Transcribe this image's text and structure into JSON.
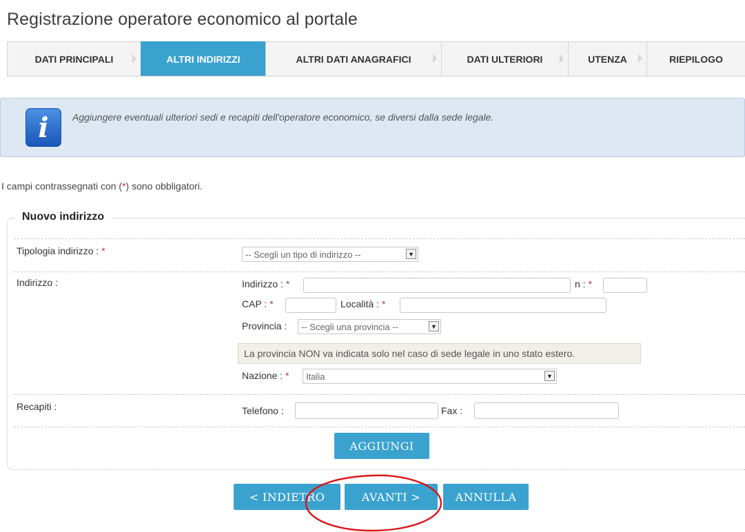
{
  "page": {
    "title": "Registrazione operatore economico al portale"
  },
  "tabs": [
    {
      "label": "DATI PRINCIPALI",
      "active": false
    },
    {
      "label": "ALTRI INDIRIZZI",
      "active": true
    },
    {
      "label": "ALTRI DATI ANAGRAFICI",
      "active": false
    },
    {
      "label": "DATI ULTERIORI",
      "active": false
    },
    {
      "label": "UTENZA",
      "active": false
    },
    {
      "label": "RIEPILOGO",
      "active": false
    }
  ],
  "info": {
    "icon": "info-icon",
    "text": "Aggiungere eventuali ulteriori sedi e recapiti dell'operatore economico, se diversi dalla sede legale."
  },
  "mandatory_note": {
    "prefix": "I campi contrassegnati con (",
    "star": "*",
    "suffix": ") sono obbligatori."
  },
  "form": {
    "legend": "Nuovo indirizzo",
    "tipologia": {
      "label": "Tipologia indirizzo : ",
      "star": "*",
      "select_value": "-- Scegli un tipo di indirizzo --"
    },
    "indirizzo": {
      "row_label": "Indirizzo :",
      "indirizzo_label": "Indirizzo : ",
      "numero_label": "n : ",
      "cap_label": "CAP : ",
      "localita_label": "Località : ",
      "provincia_label": "Provincia : ",
      "provincia_value": "-- Scegli una provincia --",
      "notice": "La provincia NON va indicata solo nel caso di sede legale in uno stato estero.",
      "nazione_label": "Nazione : ",
      "nazione_value": "Italia",
      "star": "*"
    },
    "recapiti": {
      "row_label": "Recapiti :",
      "telefono_label": "Telefono :",
      "fax_label": "Fax :"
    },
    "add_button": "AGGIUNGI"
  },
  "nav": {
    "back": "< INDIETRO",
    "next": "AVANTI >",
    "cancel": "ANNULLA"
  },
  "colors": {
    "accent": "#3aa2cf",
    "annotation": "#d9141a",
    "info_bg": "#dde8f3"
  }
}
